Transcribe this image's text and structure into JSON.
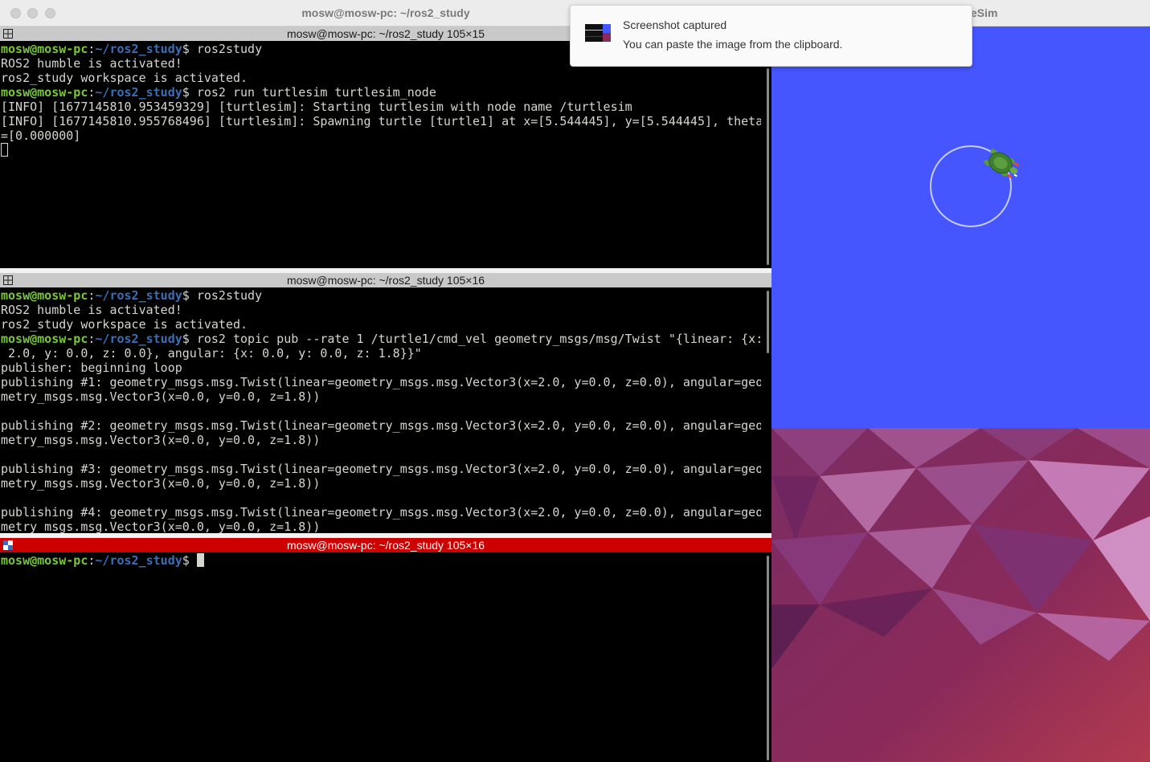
{
  "terminal_window": {
    "title": "mosw@mosw-pc: ~/ros2_study"
  },
  "prompt": {
    "user_host": "mosw@mosw-pc",
    "colon": ":",
    "path": "~/ros2_study",
    "dollar": "$"
  },
  "pane1": {
    "header": "mosw@mosw-pc: ~/ros2_study 105×15",
    "lines": [
      {
        "prompt": true,
        "cmd": "ros2study"
      },
      {
        "text": "ROS2 humble is activated!"
      },
      {
        "text": "ros2_study workspace is activated."
      },
      {
        "prompt": true,
        "cmd": "ros2 run turtlesim turtlesim_node"
      },
      {
        "text": "[INFO] [1677145810.953459329] [turtlesim]: Starting turtlesim with node name /turtlesim"
      },
      {
        "text": "[INFO] [1677145810.955768496] [turtlesim]: Spawning turtle [turtle1] at x=[5.544445], y=[5.544445], theta"
      },
      {
        "text": "=[0.000000]"
      },
      {
        "cursor": "hollow"
      }
    ]
  },
  "pane2": {
    "header": "mosw@mosw-pc: ~/ros2_study 105×16",
    "lines": [
      {
        "prompt": true,
        "cmd": "ros2study"
      },
      {
        "text": "ROS2 humble is activated!"
      },
      {
        "text": "ros2_study workspace is activated."
      },
      {
        "prompt": true,
        "cmd": "ros2 topic pub --rate 1 /turtle1/cmd_vel geometry_msgs/msg/Twist \"{linear: {x:"
      },
      {
        "text": " 2.0, y: 0.0, z: 0.0}, angular: {x: 0.0, y: 0.0, z: 1.8}}\""
      },
      {
        "text": "publisher: beginning loop"
      },
      {
        "text": "publishing #1: geometry_msgs.msg.Twist(linear=geometry_msgs.msg.Vector3(x=2.0, y=0.0, z=0.0), angular=geo"
      },
      {
        "text": "metry_msgs.msg.Vector3(x=0.0, y=0.0, z=1.8))"
      },
      {
        "text": ""
      },
      {
        "text": "publishing #2: geometry_msgs.msg.Twist(linear=geometry_msgs.msg.Vector3(x=2.0, y=0.0, z=0.0), angular=geo"
      },
      {
        "text": "metry_msgs.msg.Vector3(x=0.0, y=0.0, z=1.8))"
      },
      {
        "text": ""
      },
      {
        "text": "publishing #3: geometry_msgs.msg.Twist(linear=geometry_msgs.msg.Vector3(x=2.0, y=0.0, z=0.0), angular=geo"
      },
      {
        "text": "metry_msgs.msg.Vector3(x=0.0, y=0.0, z=1.8))"
      },
      {
        "text": ""
      },
      {
        "text": "publishing #4: geometry_msgs.msg.Twist(linear=geometry_msgs.msg.Vector3(x=2.0, y=0.0, z=0.0), angular=geo"
      },
      {
        "text": "metry_msgs.msg.Vector3(x=0.0, y=0.0, z=1.8))"
      }
    ]
  },
  "pane3": {
    "header": "mosw@mosw-pc: ~/ros2_study 105×16",
    "lines": [
      {
        "prompt": true,
        "cmd": "",
        "cursor": "solid"
      }
    ]
  },
  "turtlesim_window": {
    "title_visible": "eSim"
  },
  "notification": {
    "title": "Screenshot captured",
    "body": "You can paste the image from the clipboard."
  },
  "colors": {
    "prompt_user": "#78c83a",
    "prompt_path": "#3a6fb5",
    "terminal_text": "#d3d7cf",
    "active_header": "#cc0000",
    "turtlesim_bg": "#4556ff"
  }
}
